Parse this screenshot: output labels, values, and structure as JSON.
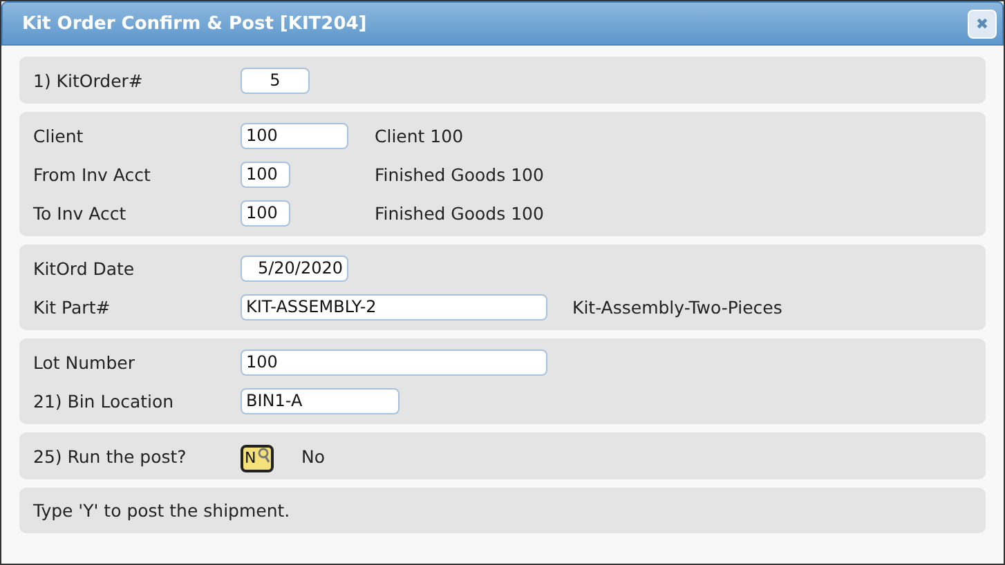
{
  "window": {
    "title": "Kit Order Confirm & Post [KIT204]",
    "close": "✖"
  },
  "sections": [
    {
      "rows": [
        {
          "label": "1) KitOrder#",
          "kind": "number",
          "value": "5"
        }
      ]
    },
    {
      "rows": [
        {
          "label": "Client",
          "kind": "code",
          "value": "100",
          "description": "Client 100"
        },
        {
          "label": "From Inv Acct",
          "kind": "account",
          "value": "100",
          "description": "Finished Goods 100"
        },
        {
          "label": "To Inv Acct",
          "kind": "account",
          "value": "100",
          "description": "Finished Goods 100"
        }
      ]
    },
    {
      "rows": [
        {
          "label": "KitOrd Date",
          "kind": "date",
          "value": "5/20/2020"
        },
        {
          "label": "Kit Part#",
          "kind": "long",
          "value": "KIT-ASSEMBLY-2",
          "description": "Kit-Assembly-Two-Pieces"
        }
      ]
    },
    {
      "rows": [
        {
          "label": "Lot Number",
          "kind": "long",
          "value": "100"
        },
        {
          "label": "21) Bin Location",
          "kind": "medium",
          "value": "BIN1-A"
        }
      ]
    },
    {
      "rows": [
        {
          "label": "25) Run the post?",
          "kind": "flag",
          "value": "N",
          "description": "No"
        }
      ]
    },
    {
      "note": "Type 'Y' to post the shipment."
    }
  ]
}
